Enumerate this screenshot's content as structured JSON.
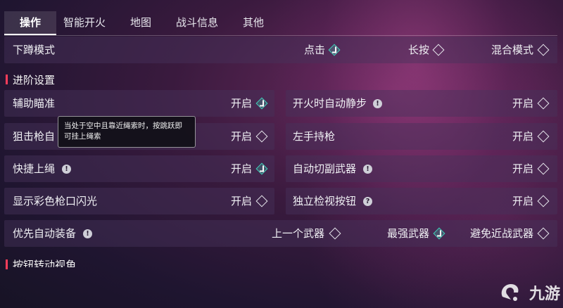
{
  "tabs": [
    {
      "label": "操作",
      "active": true
    },
    {
      "label": "智能开火"
    },
    {
      "label": "地图"
    },
    {
      "label": "战斗信息"
    },
    {
      "label": "其他"
    }
  ],
  "crouch": {
    "label": "下蹲模式",
    "options": [
      {
        "label": "点击",
        "checked": true
      },
      {
        "label": "长按",
        "checked": false
      },
      {
        "label": "混合模式",
        "checked": false
      }
    ]
  },
  "advanced": {
    "title": "进阶设置",
    "left": [
      {
        "label": "辅助瞄准",
        "option": "开启",
        "checked": true
      },
      {
        "label": "狙击枪自",
        "option": "开启",
        "checked": false
      },
      {
        "label": "快捷上绳",
        "option": "开启",
        "checked": true,
        "info": "!"
      },
      {
        "label": "显示彩色枪口闪光",
        "option": "开启",
        "checked": false
      }
    ],
    "right": [
      {
        "label": "开火时自动静步",
        "option": "开启",
        "checked": false,
        "info": "!"
      },
      {
        "label": "左手持枪",
        "option": "开启",
        "checked": false
      },
      {
        "label": "自动切副武器",
        "option": "开启",
        "checked": false,
        "info": "!"
      },
      {
        "label": "独立检视按钮",
        "option": "开启",
        "checked": false,
        "info": "?"
      }
    ]
  },
  "auto_equip": {
    "label": "优先自动装备",
    "info": "!",
    "options": [
      {
        "label": "上一个武器",
        "checked": false
      },
      {
        "label": "最强武器",
        "checked": true
      },
      {
        "label": "避免近战武器",
        "checked": false
      }
    ]
  },
  "next_section": {
    "title": "按钮转动视角"
  },
  "tooltip": {
    "text": "当处于空中且靠近绳索时，按跳跃即可挂上绳索"
  },
  "logo": {
    "text": "九游"
  },
  "colors": {
    "check": "#3fd0b8",
    "section_bar": "#ff3d5a"
  }
}
